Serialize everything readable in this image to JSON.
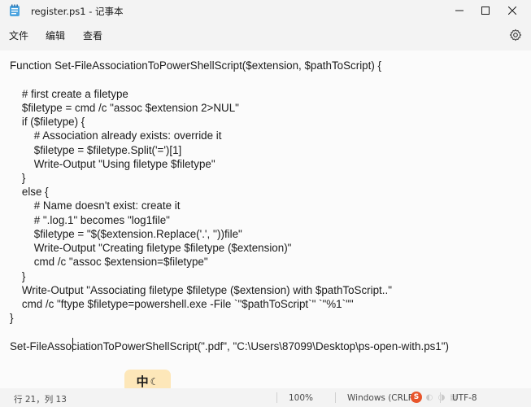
{
  "window": {
    "title": "register.ps1 - 记事本",
    "app_icon": "notepad-icon",
    "controls": [
      "minimize-icon",
      "maximize-icon",
      "close-icon"
    ]
  },
  "menu": {
    "file": "文件",
    "edit": "编辑",
    "view": "查看",
    "settings_icon": "gear-icon"
  },
  "editor": {
    "lines": [
      "Function Set-FileAssociationToPowerShellScript($extension, $pathToScript) {",
      "",
      "    # first create a filetype",
      "    $filetype = cmd /c \"assoc $extension 2>NUL\"",
      "    if ($filetype) {",
      "        # Association already exists: override it",
      "        $filetype = $filetype.Split('=')[1]",
      "        Write-Output \"Using filetype $filetype\"",
      "    }",
      "    else {",
      "        # Name doesn't exist: create it",
      "        # \".log.1\" becomes \"log1file\"",
      "        $filetype = \"$($extension.Replace('.', ''))file\"",
      "        Write-Output \"Creating filetype $filetype ($extension)\"",
      "        cmd /c \"assoc $extension=$filetype\"",
      "    }",
      "    Write-Output \"Associating filetype $filetype ($extension) with $pathToScript..\"",
      "    cmd /c \"ftype $filetype=powershell.exe -File `\"$pathToScript`\" `\"%1`\"\"",
      "}",
      "",
      "Set-FileAssociationToPowerShellScript(\".pdf\", \"C:\\Users\\87099\\Desktop\\ps-open-with.ps1\")"
    ]
  },
  "ime": {
    "label": "中",
    "mode_icon": "moon-icon",
    "mode_glyph": "☾"
  },
  "status": {
    "position": "行 21，列 13",
    "zoom": "100%",
    "line_ending": "Windows (CRLF)",
    "encoding": "UTF-8",
    "tray_s": "S"
  }
}
